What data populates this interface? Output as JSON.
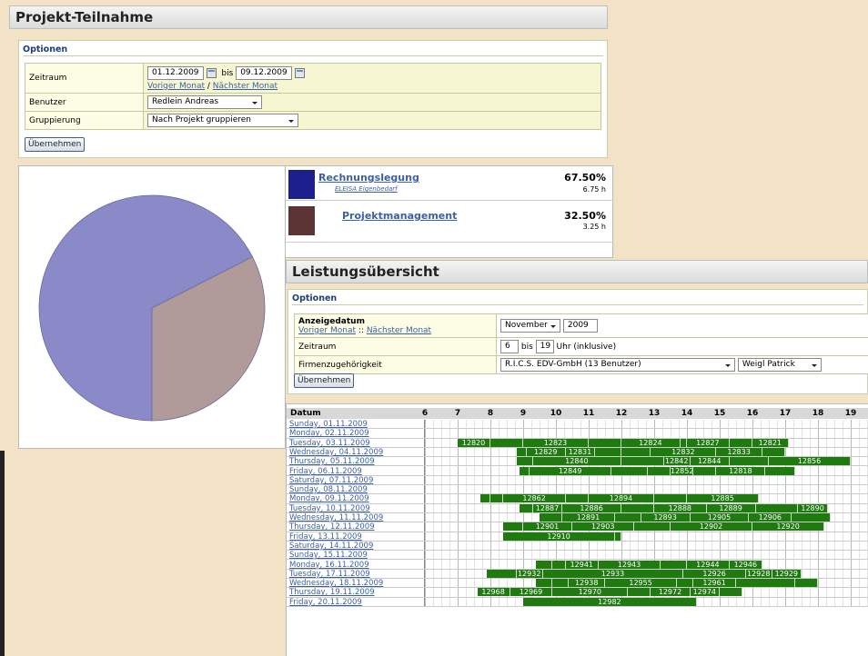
{
  "teilnahme": {
    "title": "Projekt-Teilnahme",
    "options_legend": "Optionen",
    "zeitraum_label": "Zeitraum",
    "date_from": "01.12.2009",
    "bis": "bis",
    "date_to": "09.12.2009",
    "prev_month": "Voriger Monat",
    "sep": "/",
    "next_month": "Nächster Monat",
    "benutzer_label": "Benutzer",
    "benutzer_value": "Redlein Andreas",
    "gruppierung_label": "Gruppierung",
    "gruppierung_value": "Nach Projekt gruppieren",
    "apply": "Übernehmen"
  },
  "pie": {
    "legend": [
      {
        "name": "Rechnungslegung",
        "sub": "ELEISA Eigenbedarf",
        "pct": "67.50%",
        "hours": "6.75 h",
        "color": "#1d1f8c"
      },
      {
        "name": "Projektmanagement",
        "sub": "",
        "pct": "32.50%",
        "hours": "3.25 h",
        "color": "#5c3335"
      }
    ],
    "slice_colors": [
      "#8b8ac9",
      "#b09a9a"
    ]
  },
  "chart_data": {
    "type": "pie",
    "categories": [
      "Rechnungslegung",
      "Projektmanagement"
    ],
    "values": [
      67.5,
      32.5
    ],
    "hours": [
      6.75,
      3.25
    ]
  },
  "leistung": {
    "title": "Leistungsübersicht",
    "options_legend": "Optionen",
    "anzeige_label": "Anzeigedatum",
    "prev_month": "Voriger Monat",
    "sep": "::",
    "next_month": "Nächster Monat",
    "month_value": "November",
    "year_value": "2009",
    "zeitraum_label": "Zeitraum",
    "from_hour": "6",
    "bis": "bis",
    "to_hour": "19",
    "uhr": "Uhr (inklusive)",
    "firma_label": "Firmenzugehörigkeit",
    "firma_value": "R.I.C.S. EDV-GmbH (13 Benutzer)",
    "person_value": "Weigl Patrick",
    "apply": "Übernehmen"
  },
  "gantt": {
    "date_header": "Datum",
    "hours": [
      "6",
      "7",
      "8",
      "9",
      "10",
      "11",
      "12",
      "13",
      "14",
      "15",
      "16",
      "17",
      "18",
      "19"
    ],
    "rows": [
      {
        "date": "Sunday, 01.11.2009",
        "bars": []
      },
      {
        "date": "Monday, 02.11.2009",
        "bars": []
      },
      {
        "date": "Tuesday, 03.11.2009",
        "bars": [
          [
            7,
            8,
            "12820"
          ],
          [
            8,
            9,
            ""
          ],
          [
            9,
            11,
            "12823"
          ],
          [
            11,
            12,
            ""
          ],
          [
            12,
            13.8,
            "12824"
          ],
          [
            13.8,
            14,
            ""
          ],
          [
            14,
            15.3,
            "12827"
          ],
          [
            15.3,
            16,
            ""
          ],
          [
            16,
            17.1,
            "12821"
          ]
        ]
      },
      {
        "date": "Wednesday, 04.11.2009",
        "bars": [
          [
            8.8,
            9.1,
            ""
          ],
          [
            9.1,
            10.3,
            "12829"
          ],
          [
            10.3,
            11.2,
            "12831"
          ],
          [
            11.2,
            12,
            ""
          ],
          [
            12,
            12.9,
            ""
          ],
          [
            12.9,
            14.9,
            "12832"
          ],
          [
            14.9,
            16.3,
            "12833"
          ],
          [
            16.3,
            17,
            ""
          ]
        ]
      },
      {
        "date": "Thursday, 05.11.2009",
        "bars": [
          [
            8.8,
            9.3,
            ""
          ],
          [
            9.3,
            12,
            "12840"
          ],
          [
            12,
            13.3,
            ""
          ],
          [
            13.3,
            14.1,
            "12842"
          ],
          [
            14.1,
            15.3,
            "12844"
          ],
          [
            15.3,
            16.5,
            ""
          ],
          [
            16.5,
            19,
            "12856"
          ]
        ]
      },
      {
        "date": "Friday, 06.11.2009",
        "bars": [
          [
            8.9,
            9.2,
            ""
          ],
          [
            9.2,
            11.7,
            "12849"
          ],
          [
            11.7,
            12.8,
            ""
          ],
          [
            12.8,
            13.5,
            ""
          ],
          [
            13.5,
            14.2,
            "12852"
          ],
          [
            14.2,
            14.9,
            ""
          ],
          [
            14.9,
            16.4,
            "12818"
          ],
          [
            16.4,
            17.3,
            ""
          ]
        ]
      },
      {
        "date": "Saturday, 07.11.2009",
        "bars": []
      },
      {
        "date": "Sunday, 08.11.2009",
        "bars": []
      },
      {
        "date": "Monday, 09.11.2009",
        "bars": [
          [
            7.7,
            8,
            ""
          ],
          [
            8,
            8.4,
            ""
          ],
          [
            8.4,
            10.3,
            "12862"
          ],
          [
            10.3,
            11,
            ""
          ],
          [
            11,
            13,
            "12894"
          ],
          [
            13,
            14,
            ""
          ],
          [
            14,
            16.2,
            "12885"
          ]
        ]
      },
      {
        "date": "Tuesday, 10.11.2009",
        "bars": [
          [
            8.9,
            9.3,
            ""
          ],
          [
            9.3,
            10.2,
            "12887"
          ],
          [
            10.2,
            12,
            "12886"
          ],
          [
            12,
            13,
            ""
          ],
          [
            13,
            14.6,
            "12888"
          ],
          [
            14.6,
            16.1,
            "12889"
          ],
          [
            16.1,
            17.4,
            ""
          ],
          [
            17.4,
            18.3,
            "12890"
          ]
        ]
      },
      {
        "date": "Wednesday, 11.11.2009",
        "bars": [
          [
            9.5,
            10.2,
            ""
          ],
          [
            10.2,
            11.8,
            "12891"
          ],
          [
            11.8,
            12.6,
            ""
          ],
          [
            12.6,
            14.1,
            "12893"
          ],
          [
            14.1,
            15.9,
            "12905"
          ],
          [
            15.9,
            17.2,
            "12906"
          ],
          [
            17.2,
            18.4,
            ""
          ]
        ]
      },
      {
        "date": "Thursday, 12.11.2009",
        "bars": [
          [
            8.4,
            9,
            ""
          ],
          [
            9,
            10.5,
            "12901"
          ],
          [
            10.5,
            12.4,
            "12903"
          ],
          [
            12.4,
            13.5,
            ""
          ],
          [
            13.5,
            16,
            "12902"
          ],
          [
            16,
            18.2,
            "12920"
          ]
        ]
      },
      {
        "date": "Friday, 13.11.2009",
        "bars": [
          [
            8.4,
            11.8,
            "12910"
          ],
          [
            11.8,
            12,
            ""
          ]
        ]
      },
      {
        "date": "Saturday, 14.11.2009",
        "bars": []
      },
      {
        "date": "Sunday, 15.11.2009",
        "bars": []
      },
      {
        "date": "Monday, 16.11.2009",
        "bars": [
          [
            9.4,
            9.9,
            ""
          ],
          [
            9.9,
            10.3,
            ""
          ],
          [
            10.3,
            11.3,
            "12941"
          ],
          [
            11.3,
            13.2,
            "12943"
          ],
          [
            13.2,
            14,
            ""
          ],
          [
            14,
            15.3,
            "12944"
          ],
          [
            15.3,
            16.3,
            "12946"
          ]
        ]
      },
      {
        "date": "Tuesday, 17.11.2009",
        "bars": [
          [
            7.9,
            8.8,
            ""
          ],
          [
            8.8,
            9.6,
            "12932"
          ],
          [
            9.6,
            13.9,
            "12933"
          ],
          [
            13.9,
            15.8,
            "12926"
          ],
          [
            15.8,
            16.6,
            "12928"
          ],
          [
            16.6,
            17.5,
            "12929"
          ]
        ]
      },
      {
        "date": "Wednesday, 18.11.2009",
        "bars": [
          [
            9.4,
            9.9,
            ""
          ],
          [
            9.9,
            10.4,
            ""
          ],
          [
            10.4,
            11.5,
            "12938"
          ],
          [
            11.5,
            13.7,
            "12955"
          ],
          [
            13.7,
            14.2,
            ""
          ],
          [
            14.2,
            15.5,
            "12961"
          ],
          [
            15.5,
            17.3,
            ""
          ],
          [
            17.3,
            18,
            ""
          ]
        ]
      },
      {
        "date": "Thursday, 19.11.2009",
        "bars": [
          [
            7.6,
            8.6,
            "12968"
          ],
          [
            8.6,
            9.9,
            "12969"
          ],
          [
            9.9,
            12.2,
            "12970"
          ],
          [
            12.2,
            12.9,
            ""
          ],
          [
            12.9,
            14.1,
            "12972"
          ],
          [
            14.1,
            15,
            "12974"
          ],
          [
            15,
            15.7,
            ""
          ]
        ]
      },
      {
        "date": "Friday, 20.11.2009",
        "bars": [
          [
            9,
            14.3,
            "12982"
          ]
        ]
      }
    ]
  }
}
